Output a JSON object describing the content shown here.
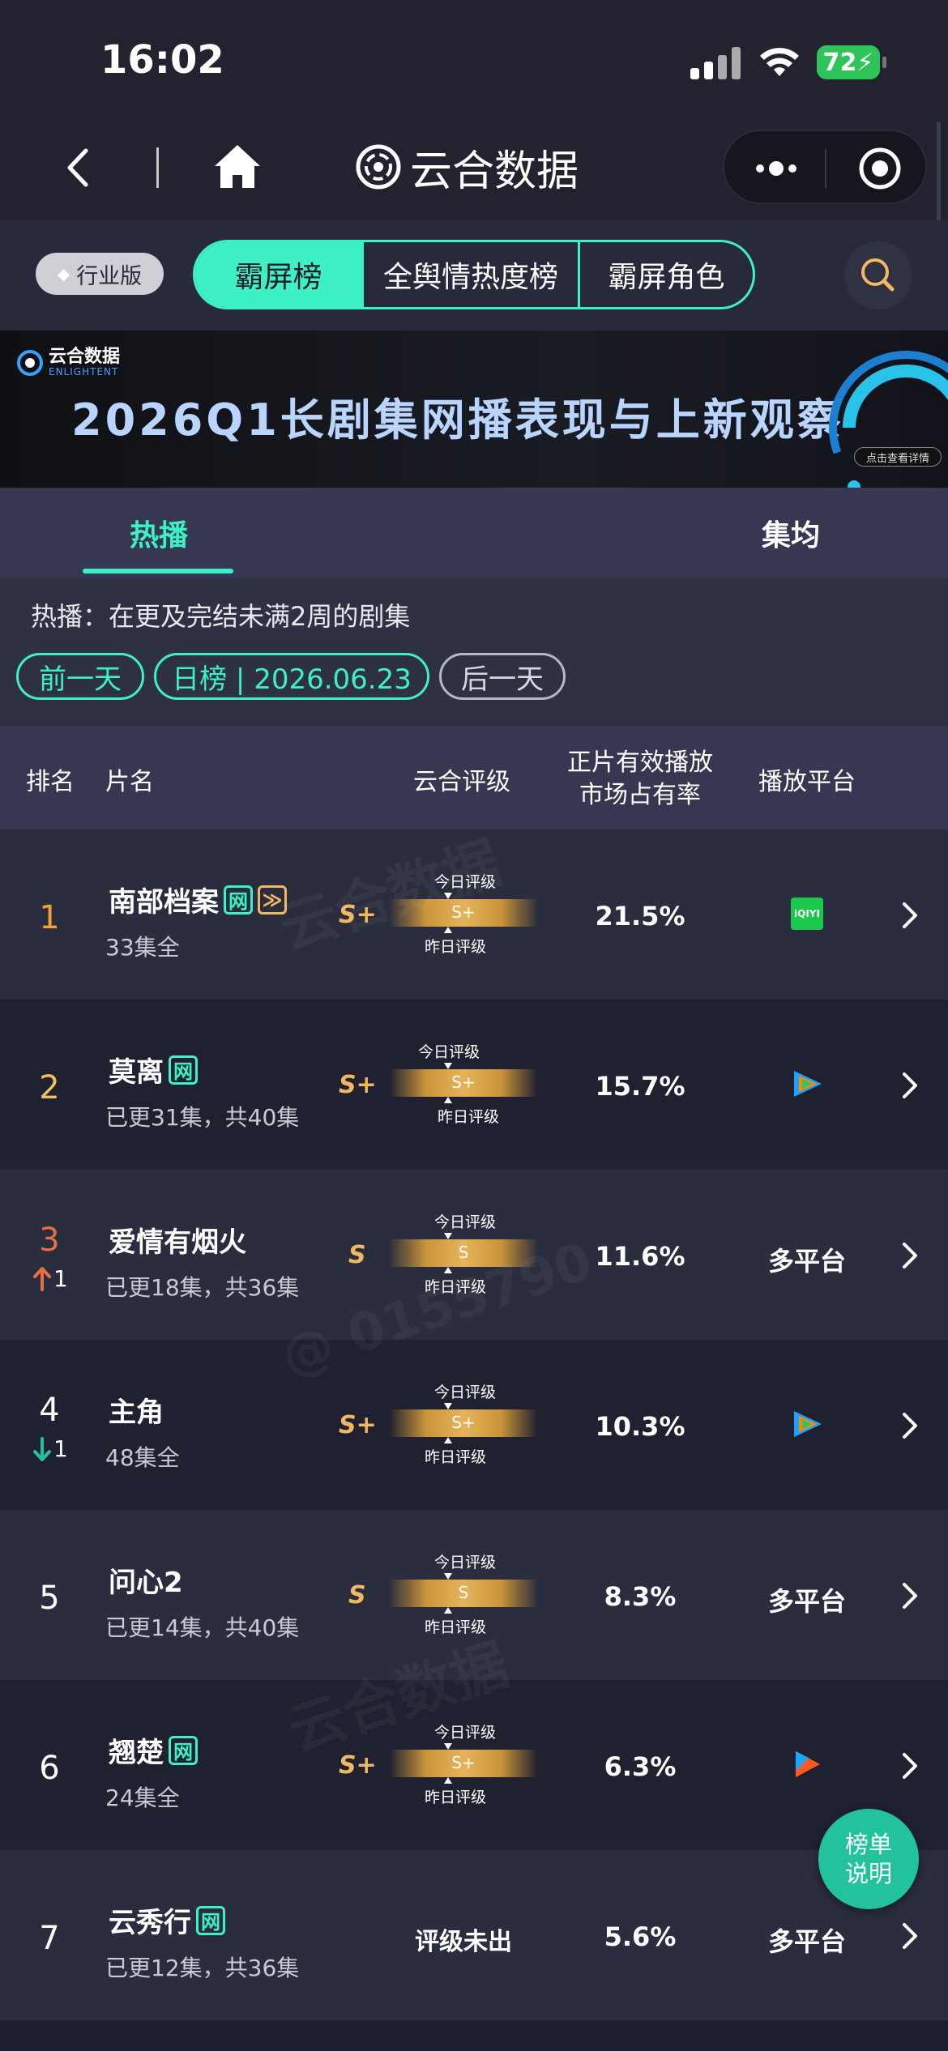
{
  "status_bar": {
    "time": "16:02",
    "battery": "72"
  },
  "nav": {
    "app_name": "云合数据"
  },
  "tabs": {
    "edition": "行业版",
    "items": [
      "霸屏榜",
      "全舆情热度榜",
      "霸屏角色"
    ],
    "active": 0
  },
  "banner": {
    "logo_cn": "云合数据",
    "logo_en": "ENLIGHTENT",
    "title": "2026Q1长剧集网播表现与上新观察",
    "tag": "点击查看详情"
  },
  "subtabs": {
    "hot": "热播",
    "avg": "集均"
  },
  "filter": {
    "description": "热播：在更及完结未满2周的剧集",
    "prev": "前一天",
    "current": "日榜 | 2026.06.23",
    "next": "后一天"
  },
  "table_header": {
    "rank": "排名",
    "title": "片名",
    "grade": "云合评级",
    "share_line1": "正片有效播放",
    "share_line2": "市场占有率",
    "platform": "播放平台"
  },
  "gauge_labels": {
    "today": "今日评级",
    "yesterday": "昨日评级"
  },
  "rows": [
    {
      "rank": "1",
      "title": "南部档案",
      "badges": [
        "网",
        "≫"
      ],
      "episodes": "33集全",
      "grade": "S+",
      "bar": "S+",
      "share": "21.5%",
      "platform_icon": "iqiyi-icon",
      "platform_text": "iQIYI",
      "trend": "",
      "trend_num": ""
    },
    {
      "rank": "2",
      "title": "莫离",
      "badges": [
        "网"
      ],
      "episodes": "已更31集，共40集",
      "grade": "S+",
      "bar": "S+",
      "share": "15.7%",
      "platform_icon": "tencent-video-icon",
      "platform_text": "",
      "trend": "",
      "trend_num": ""
    },
    {
      "rank": "3",
      "title": "爱情有烟火",
      "badges": [],
      "episodes": "已更18集，共36集",
      "grade": "S",
      "bar": "S",
      "share": "11.6%",
      "platform_icon": "",
      "platform_text": "多平台",
      "trend": "up",
      "trend_num": "1"
    },
    {
      "rank": "4",
      "title": "主角",
      "badges": [],
      "episodes": "48集全",
      "grade": "S+",
      "bar": "S+",
      "share": "10.3%",
      "platform_icon": "tencent-video-icon",
      "platform_text": "",
      "trend": "down",
      "trend_num": "1"
    },
    {
      "rank": "5",
      "title": "问心2",
      "badges": [],
      "episodes": "已更14集，共40集",
      "grade": "S",
      "bar": "S",
      "share": "8.3%",
      "platform_icon": "",
      "platform_text": "多平台",
      "trend": "",
      "trend_num": ""
    },
    {
      "rank": "6",
      "title": "翘楚",
      "badges": [
        "网"
      ],
      "episodes": "24集全",
      "grade": "S+",
      "bar": "S+",
      "share": "6.3%",
      "platform_icon": "youku-icon",
      "platform_text": "",
      "trend": "",
      "trend_num": ""
    },
    {
      "rank": "7",
      "title": "云秀行",
      "badges": [
        "网"
      ],
      "episodes": "已更12集，共36集",
      "grade": "",
      "bar": "",
      "share": "5.6%",
      "platform_icon": "",
      "platform_text": "多平台",
      "no_grade": "评级未出",
      "trend": "",
      "trend_num": ""
    }
  ],
  "watermark": {
    "brand": "云合数据",
    "brand_en": "ENLIGHTENT",
    "id": "@ 0155790"
  },
  "fab": {
    "line1": "榜单",
    "line2": "说明"
  },
  "colors": {
    "accent": "#3ef1c5",
    "gold": "#f0b860",
    "up": "#e86e44",
    "down": "#22c39c"
  }
}
